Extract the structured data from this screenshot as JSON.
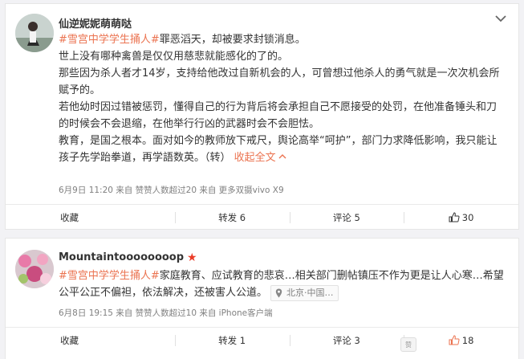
{
  "post1": {
    "username": "仙逆妮妮萌萌哒",
    "hashtag": "#雪宫中学学生捅人#",
    "paragraphs": [
      "罪恶滔天，却被要求封锁消息。",
      "世上没有哪种禽兽是仅仅用慈悲就能感化的了的。",
      "那些因为杀人者才14岁，支持给他改过自新机会的人，可曾想过他杀人的勇气就是一次次机会所赋予的。",
      "若他幼时因过错被惩罚，懂得自己的行为背后将会承担自己不愿接受的处罚，在他准备锤头和刀的时候会不会退缩，在他举行行凶的武器时会不会胆怯。",
      "教育，是国之根本。面对如今的教师放下戒尺，舆论高举“呵护”，部门力求降低影响，我只能让孩子先学跆拳道，再学語数英。（转）"
    ],
    "collapse_label": "收起全文",
    "meta": "6月9日 11:20 来自 赞赞人数超过20 来自 更多双摄vivo X9",
    "actions": {
      "favorite": "收藏",
      "repost": "转发 6",
      "comment": "评论 5",
      "like": "30"
    },
    "accent_color": "#eb7350"
  },
  "post2": {
    "username": "Mountaintoooooooop",
    "hashtag": "#雪宫中学学生捅人#",
    "text_after_hashtag": "家庭教育、应试教育的悲哀…相关部门删帖镇压不作为更是让人心寒…希望公平公正不偏袒，依法解决，还被害人公道。",
    "location": "北京·中国…",
    "meta": "6月8日 19:15 来自 赞赞人数超过10 来自 iPhone客户端",
    "actions": {
      "favorite": "收藏",
      "repost": "转发 1",
      "comment": "评论 3",
      "like": "18"
    }
  },
  "icons": {
    "more": "chevron-down-icon",
    "like": "thumbs-up-icon",
    "location": "location-pin-icon",
    "verified": "red-star-icon"
  }
}
